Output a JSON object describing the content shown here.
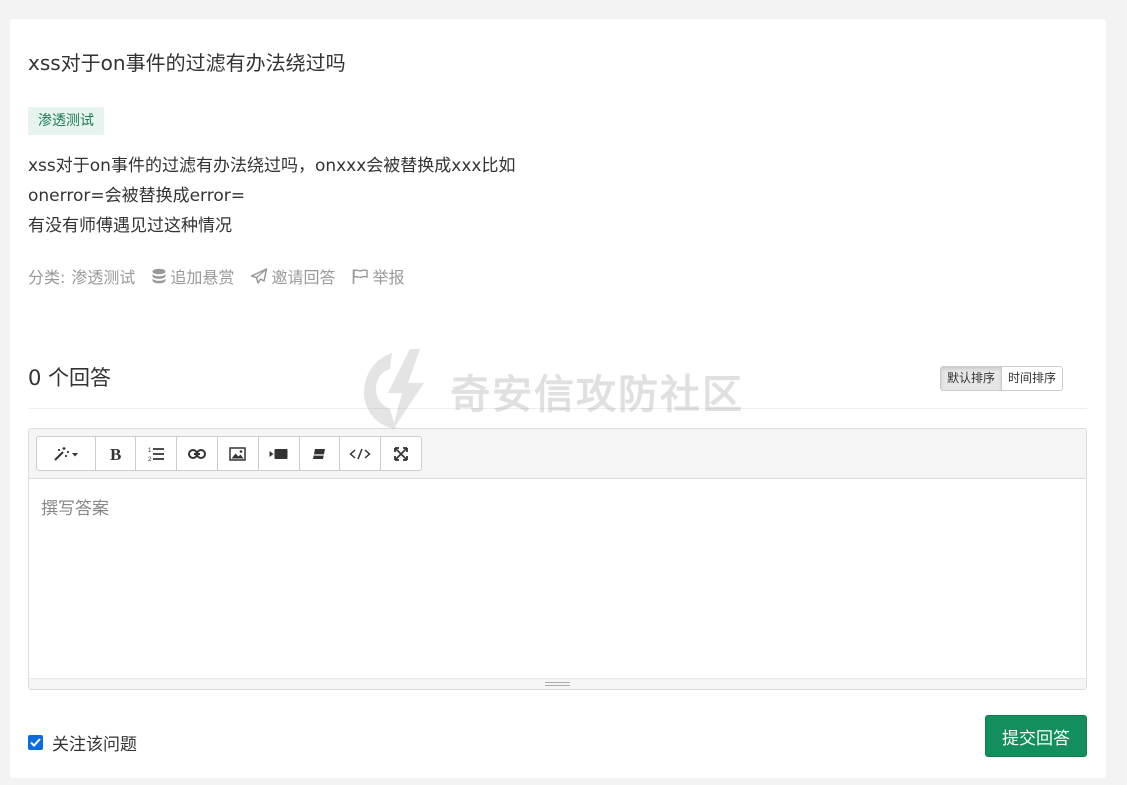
{
  "question": {
    "title": "xss对于on事件的过滤有办法绕过吗",
    "tag": "渗透测试",
    "body_lines": [
      "xss对于on事件的过滤有办法绕过吗，onxxx会被替换成xxx比如",
      "onerror=会被替换成error=",
      "有没有师傅遇见过这种情况"
    ]
  },
  "meta": {
    "category_label": "分类:",
    "category_value": "渗透测试",
    "reward": "追加悬赏",
    "invite": "邀请回答",
    "report": "举报"
  },
  "answers": {
    "title": "0 个回答",
    "sort_default": "默认排序",
    "sort_time": "时间排序"
  },
  "editor": {
    "placeholder": "撰写答案",
    "toolbar_icons": [
      "magic-wand-icon",
      "bold-icon",
      "ordered-list-icon",
      "link-icon",
      "image-icon",
      "video-icon",
      "eraser-icon",
      "code-icon",
      "fullscreen-icon"
    ]
  },
  "footer": {
    "follow_label": "关注该问题",
    "follow_checked": true,
    "submit_label": "提交回答"
  },
  "watermark": "奇安信攻防社区",
  "colors": {
    "tag_bg": "#e7f3ee",
    "tag_text": "#1c7c54",
    "submit_bg": "#138f5b",
    "checkbox": "#0b6ce0"
  }
}
